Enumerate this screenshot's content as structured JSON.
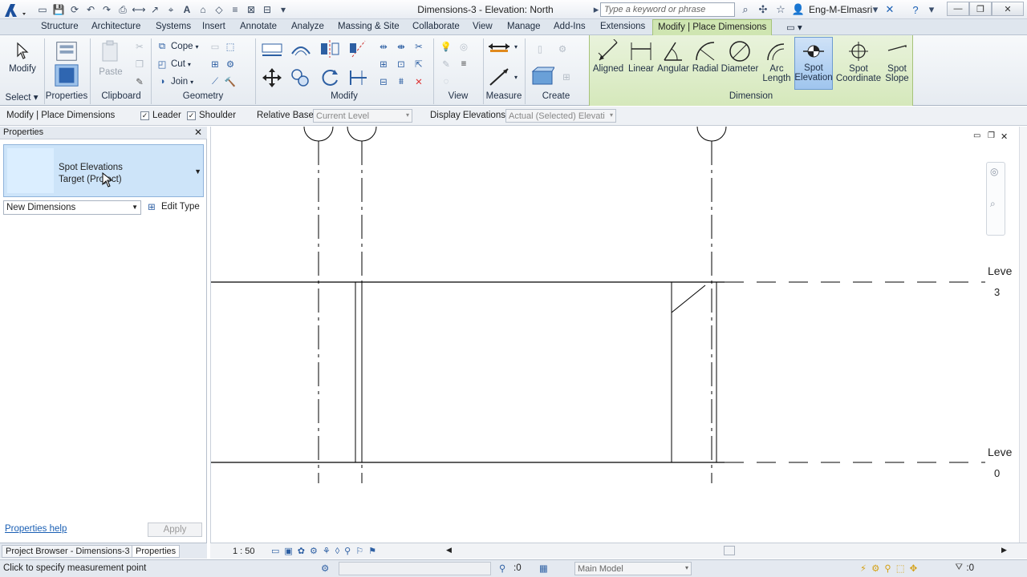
{
  "window": {
    "title": "Dimensions-3 - Elevation: North",
    "search_placeholder": "Type a keyword or phrase",
    "user": "Eng-M-Elmasri"
  },
  "ribbon_tabs": [
    "Structure",
    "Architecture",
    "Systems",
    "Insert",
    "Annotate",
    "Analyze",
    "Massing & Site",
    "Collaborate",
    "View",
    "Manage",
    "Add-Ins",
    "Extensions"
  ],
  "context_tab": "Modify | Place Dimensions",
  "ribbon": {
    "select": {
      "modify_label": "Modify",
      "panel": "Select"
    },
    "properties": {
      "label": "Properties",
      "panel": "Properties"
    },
    "clipboard": {
      "paste": "Paste",
      "panel": "Clipboard"
    },
    "geometry": {
      "cope": "Cope",
      "cut": "Cut",
      "join": "Join",
      "panel": "Geometry"
    },
    "modify": {
      "panel": "Modify"
    },
    "view": {
      "panel": "View"
    },
    "measure": {
      "panel": "Measure"
    },
    "create": {
      "panel": "Create"
    },
    "dimension": {
      "panel": "Dimension",
      "aligned": "Aligned",
      "linear": "Linear",
      "angular": "Angular",
      "radial": "Radial",
      "diameter": "Diameter",
      "arc_line1": "Arc",
      "arc_line2": "Length",
      "spot_elev_line1": "Spot",
      "spot_elev_line2": "Elevation",
      "spot_coord_line1": "Spot",
      "spot_coord_line2": "Coordinate",
      "spot_slope_line1": "Spot",
      "spot_slope_line2": "Slope"
    }
  },
  "options_bar": {
    "context": "Modify | Place Dimensions",
    "leader": "Leader",
    "shoulder": "Shoulder",
    "relative_base_label": "Relative Base:",
    "relative_base_value": "Current Level",
    "display_elev_label": "Display Elevations:",
    "display_elev_value": "Actual (Selected) Elevati"
  },
  "properties": {
    "header": "Properties",
    "family": "Spot Elevations",
    "type": "Target (Project)",
    "instance": "New Dimensions",
    "edit_type": "Edit Type",
    "help": "Properties help",
    "apply": "Apply"
  },
  "bottom_tabs": [
    "Project Browser - Dimensions-3",
    "Properties"
  ],
  "view": {
    "scale": "1 : 50",
    "level_top_name": "Leve",
    "level_top_num": "3",
    "level_bottom_name": "Leve",
    "level_bottom_num": "0"
  },
  "status": {
    "text": "Click to specify measurement point",
    "worksets": ":0",
    "model": "Main Model",
    "filter": ":0"
  }
}
